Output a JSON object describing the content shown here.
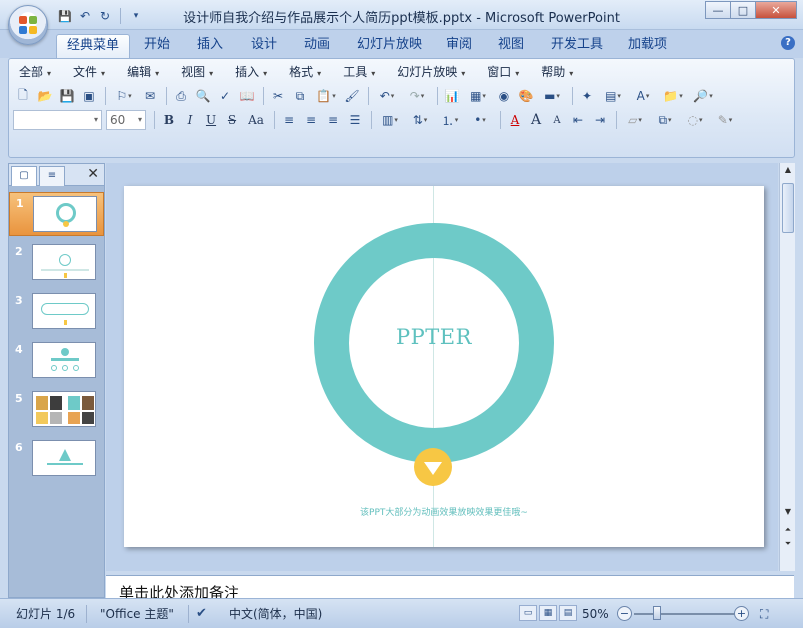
{
  "window": {
    "title": "设计师自我介绍与作品展示个人简历ppt模板.pptx - Microsoft PowerPoint",
    "minimize": "—",
    "maximize": "□",
    "close": "✕"
  },
  "quick_access": {
    "save": "💾",
    "undo": "↶",
    "redo": "↻",
    "more": "▾"
  },
  "tabs": [
    "经典菜单",
    "开始",
    "插入",
    "设计",
    "动画",
    "幻灯片放映",
    "审阅",
    "视图",
    "开发工具",
    "加载项"
  ],
  "help_label": "?",
  "menus": [
    "全部",
    "文件",
    "编辑",
    "视图",
    "插入",
    "格式",
    "工具",
    "幻灯片放映",
    "窗口",
    "帮助"
  ],
  "toolbar": {
    "font_name": "",
    "font_size": "60",
    "bold": "B",
    "italic": "I",
    "underline": "U",
    "strikethrough": "S",
    "change_case": "Aa",
    "font_color": "A",
    "grow_font": "A",
    "shrink_font": "A"
  },
  "slide_panel": {
    "tab_slides_icon": "▢",
    "tab_outline_icon": "≡",
    "close": "✕",
    "slides": [
      "1",
      "2",
      "3",
      "4",
      "5",
      "6"
    ],
    "selected": "1"
  },
  "slide": {
    "title": "PPTER",
    "caption": "该PPT大部分为动画效果放映效果更佳哦~",
    "colors": {
      "ring": "#6ecac8",
      "arrow": "#f7c744",
      "text": "#5fc1bf"
    }
  },
  "notes": {
    "placeholder": "单击此处添加备注"
  },
  "status": {
    "slide_info": "幻灯片 1/6",
    "theme": "\"Office 主题\"",
    "language": "中文(简体，中国)",
    "zoom": "50%",
    "zoom_fraction": 0.2
  }
}
